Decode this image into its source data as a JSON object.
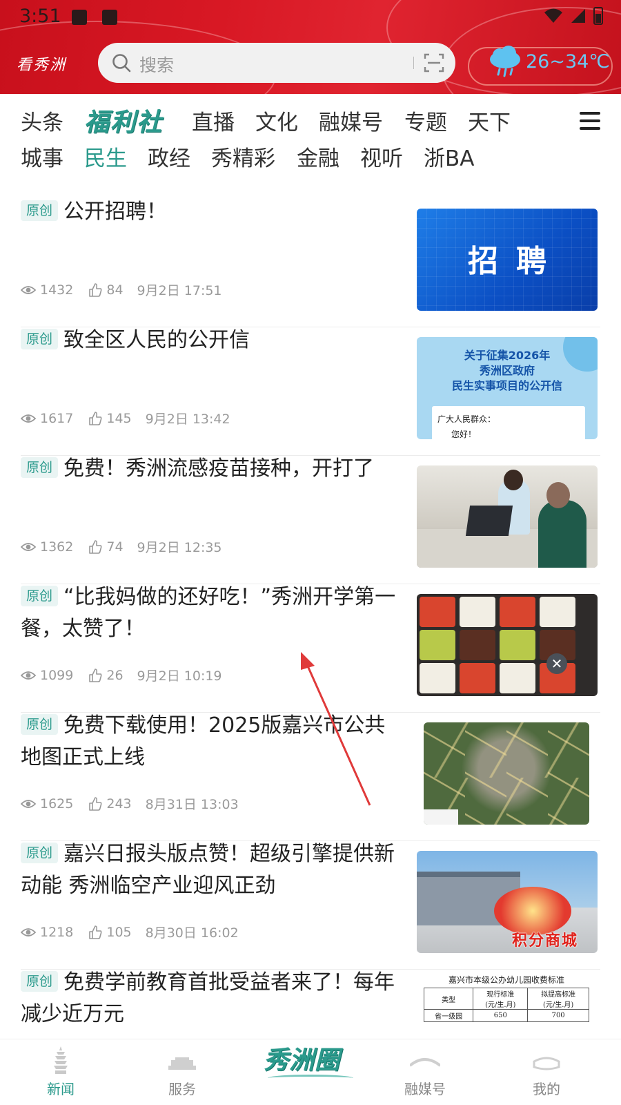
{
  "status_bar": {
    "time": "3:51"
  },
  "header": {
    "logo_text": "看秀洲",
    "search_placeholder": "搜索",
    "weather_range": "26~34℃",
    "brand_color": "#d81824"
  },
  "nav": {
    "row1": [
      "头条",
      "福利社",
      "直播",
      "文化",
      "融媒号",
      "专题",
      "天下"
    ],
    "row2": [
      "城事",
      "民生",
      "政经",
      "秀精彩",
      "金融",
      "视听",
      "浙BA"
    ],
    "active": "民生",
    "accent_color": "#2b9a8c"
  },
  "news": [
    {
      "tag": "原创",
      "title": "公开招聘！",
      "views": "1432",
      "likes": "84",
      "time": "9月2日 17:51",
      "thumb_text": "招聘"
    },
    {
      "tag": "原创",
      "title": "致全区人民的公开信",
      "views": "1617",
      "likes": "145",
      "time": "9月2日 13:42",
      "thumb_lines": [
        "关于征集2026年",
        "秀洲区政府",
        "民生实事项目的公开信"
      ],
      "thumb_salutation": "广大人民群众：",
      "thumb_greeting": "您好！"
    },
    {
      "tag": "原创",
      "title": "免费！秀洲流感疫苗接种，开打了",
      "views": "1362",
      "likes": "74",
      "time": "9月2日 12:35"
    },
    {
      "tag": "原创",
      "title": "“比我妈做的还好吃！”秀洲开学第一餐，太赞了！",
      "views": "1099",
      "likes": "26",
      "time": "9月2日 10:19"
    },
    {
      "tag": "原创",
      "title": "免费下载使用！2025版嘉兴市公共地图正式上线",
      "views": "1625",
      "likes": "243",
      "time": "8月31日 13:03"
    },
    {
      "tag": "原创",
      "title": "嘉兴日报头版点赞！超级引擎提供新动能 秀洲临空产业迎风正劲",
      "views": "1218",
      "likes": "105",
      "time": "8月30日 16:02",
      "ad_text": "积分商城"
    },
    {
      "tag": "原创",
      "title": "免费学前教育首批受益者来了！每年减少近万元",
      "table_title": "嘉兴市本级公办幼儿园收费标准",
      "table_headers": [
        "类型",
        "现行标准\n(元/生.月)",
        "拟提高标准\n(元/生.月)"
      ],
      "table_row": [
        "省一级园",
        "650",
        "700"
      ]
    }
  ],
  "bottom_nav": {
    "items": [
      "新闻",
      "服务",
      "融媒号",
      "我的"
    ],
    "center_logo": "秀洲圈",
    "active": "新闻"
  }
}
